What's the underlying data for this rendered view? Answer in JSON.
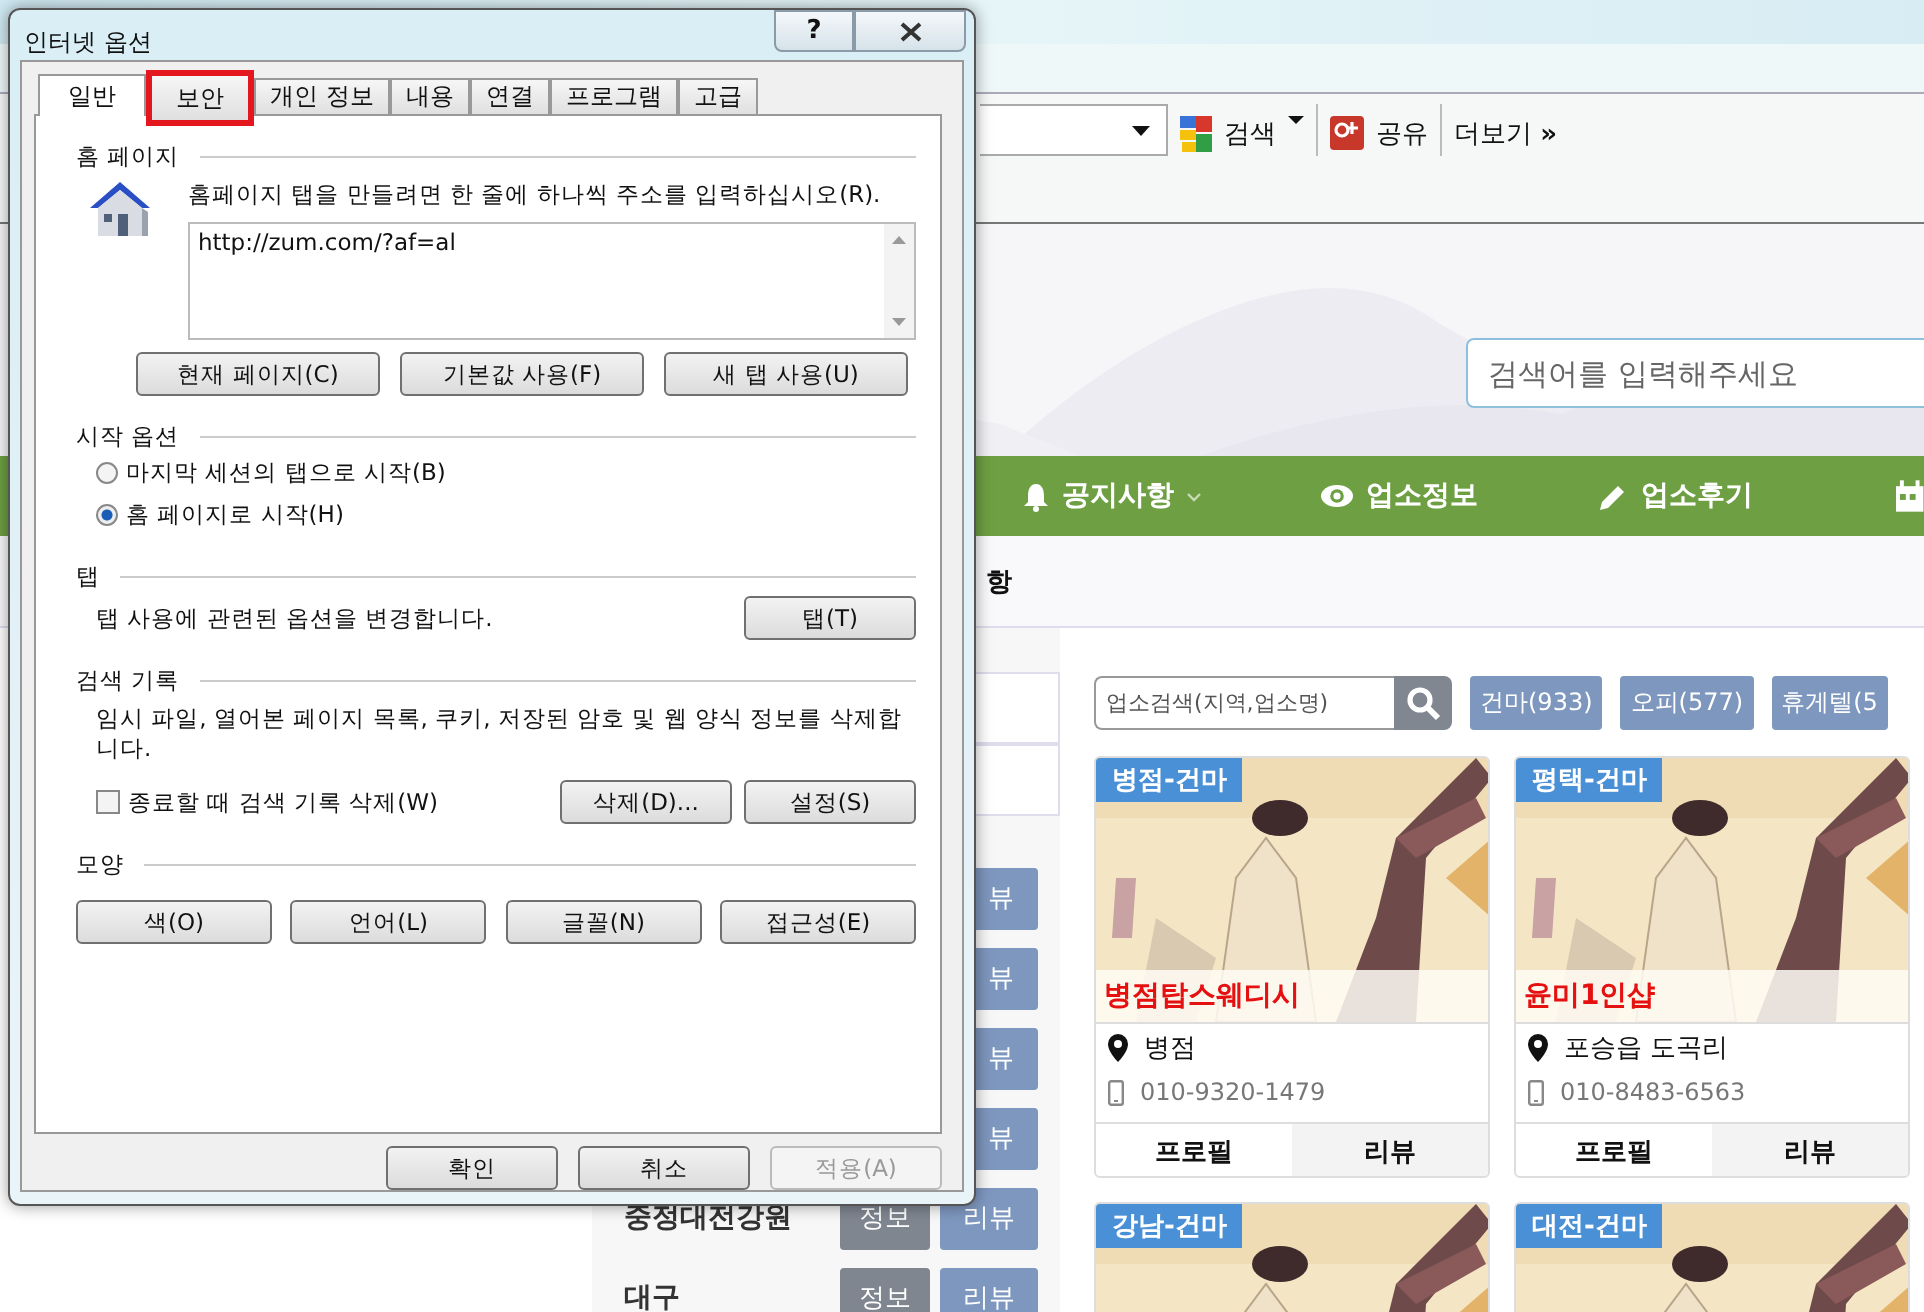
{
  "browser": {
    "toolbar": {
      "search_label": "검색",
      "share_label": "공유",
      "more_label": "더보기",
      "more_glyph": "»"
    }
  },
  "site": {
    "search_placeholder": "검색어를 입력해주세요",
    "nav": [
      {
        "label": "공지사항",
        "kind": "bell"
      },
      {
        "label": "업소정보",
        "kind": "eye"
      },
      {
        "label": "업소후기",
        "kind": "pencil"
      }
    ],
    "subnav_text": "항",
    "sidebar_rows": [
      {
        "review": "뷰"
      },
      {
        "review": "뷰"
      },
      {
        "review": "뷰"
      },
      {
        "review": "뷰"
      },
      {
        "name": "중정대전강원",
        "info": "정보",
        "review": "리뷰"
      },
      {
        "name": "대구",
        "info": "정보",
        "review": "리뷰"
      }
    ],
    "shop_search_placeholder": "업소검색(지역,업소명)",
    "filters": [
      "건마(933)",
      "오피(577)",
      "휴게텔(5"
    ],
    "cards": [
      {
        "category": "병점-건마",
        "name": "병점탑스웨디시",
        "location": "병점",
        "phone": "010-9320-1479",
        "profile": "프로필",
        "review": "리뷰"
      },
      {
        "category": "평택-건마",
        "name": "윤미1인샵",
        "location": "포승읍 도곡리",
        "phone": "010-8483-6563",
        "profile": "프로필",
        "review": "리뷰"
      },
      {
        "category": "강남-건마"
      },
      {
        "category": "대전-건마"
      }
    ]
  },
  "dialog": {
    "title": "인터넷 옵션",
    "help": "?",
    "tabs": [
      {
        "label": "일반",
        "selected": true,
        "highlighted": false
      },
      {
        "label": "보안",
        "selected": false,
        "highlighted": true
      },
      {
        "label": "개인 정보",
        "selected": false,
        "highlighted": false
      },
      {
        "label": "내용",
        "selected": false,
        "highlighted": false
      },
      {
        "label": "연결",
        "selected": false,
        "highlighted": false
      },
      {
        "label": "프로그램",
        "selected": false,
        "highlighted": false
      },
      {
        "label": "고급",
        "selected": false,
        "highlighted": false
      }
    ],
    "home": {
      "heading": "홈 페이지",
      "description": "홈페이지 탭을 만들려면 한 줄에 하나씩 주소를 입력하십시오(R).",
      "value": "http://zum.com/?af=al",
      "buttons": [
        "현재 페이지(C)",
        "기본값 사용(F)",
        "새 탭 사용(U)"
      ]
    },
    "startup": {
      "heading": "시작 옵션",
      "options": [
        {
          "label": "마지막 세션의 탭으로 시작(B)",
          "selected": false
        },
        {
          "label": "홈 페이지로 시작(H)",
          "selected": true
        }
      ]
    },
    "tabs_section": {
      "heading": "탭",
      "description": "탭 사용에 관련된 옵션을 변경합니다.",
      "button": "탭(T)"
    },
    "history": {
      "heading": "검색 기록",
      "description": "임시 파일, 열어본 페이지 목록, 쿠키, 저장된 암호 및 웹 양식 정보를 삭제합니다.",
      "checkbox": {
        "label": "종료할 때 검색 기록 삭제(W)",
        "checked": false
      },
      "buttons": [
        "삭제(D)...",
        "설정(S)"
      ]
    },
    "appearance": {
      "heading": "모양",
      "buttons": [
        "색(O)",
        "언어(L)",
        "글꼴(N)",
        "접근성(E)"
      ]
    },
    "footer": [
      {
        "label": "확인",
        "disabled": false
      },
      {
        "label": "취소",
        "disabled": false
      },
      {
        "label": "적용(A)",
        "disabled": true
      }
    ]
  }
}
